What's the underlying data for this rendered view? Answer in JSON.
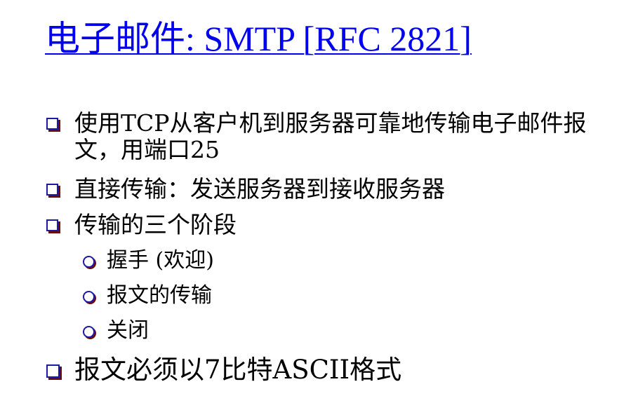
{
  "title": "电子邮件: SMTP [RFC 2821]",
  "bullets": [
    {
      "line1": "使用TCP从客户机到服务器可靠地传输电子邮件报",
      "line2": "文，用端口25"
    },
    {
      "text": "直接传输：发送服务器到接收服务器"
    },
    {
      "text": "传输的三个阶段"
    },
    {
      "text": "报文必须以7比特ASCII格式"
    }
  ],
  "sub_bullets": [
    "握手 (欢迎)",
    "报文的传输",
    "关闭"
  ],
  "colors": {
    "title": "#0000ee",
    "bullet_border": "#1a1aa6",
    "bullet_shadow": "#6b0b0b",
    "text": "#000000"
  },
  "icons": {
    "level1_bullet": "hollow-square-bullet",
    "level2_bullet": "hollow-circle-bullet"
  }
}
